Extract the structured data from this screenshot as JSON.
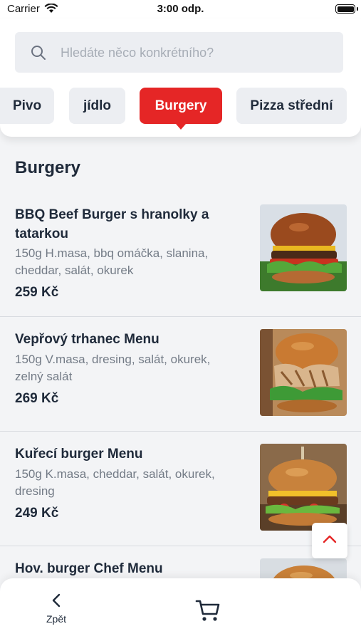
{
  "status_bar": {
    "carrier": "Carrier",
    "time": "3:00 odp."
  },
  "search": {
    "placeholder": "Hledáte něco konkrétního?"
  },
  "categories": [
    {
      "label": "Pivo",
      "active": false
    },
    {
      "label": "jídlo",
      "active": false
    },
    {
      "label": "Burgery",
      "active": true
    },
    {
      "label": "Pizza střední",
      "active": false
    }
  ],
  "section": {
    "title": "Burgery"
  },
  "items": [
    {
      "name": "BBQ Beef Burger s hranolky a tatarkou",
      "description": "150g H.masa, bbq omáčka, slanina, cheddar, salát, okurek",
      "price": "259 Kč"
    },
    {
      "name": "Vepřový trhanec Menu",
      "description": "150g V.masa, dresing, salát, okurek, zelný salát",
      "price": "269 Kč"
    },
    {
      "name": "Kuřecí burger Menu",
      "description": "150g K.masa, cheddar, salát, okurek, dresing",
      "price": "249 Kč"
    },
    {
      "name": "Hov. burger Chef Menu",
      "description": "",
      "price": ""
    }
  ],
  "bottom_nav": {
    "back_label": "Zpět"
  },
  "colors": {
    "accent": "#e52626",
    "text": "#1f2a3a",
    "muted": "#737b86"
  },
  "icons": [
    "wifi-icon",
    "battery-icon",
    "search-icon",
    "chevron-up-icon",
    "chevron-left-icon",
    "cart-icon"
  ]
}
